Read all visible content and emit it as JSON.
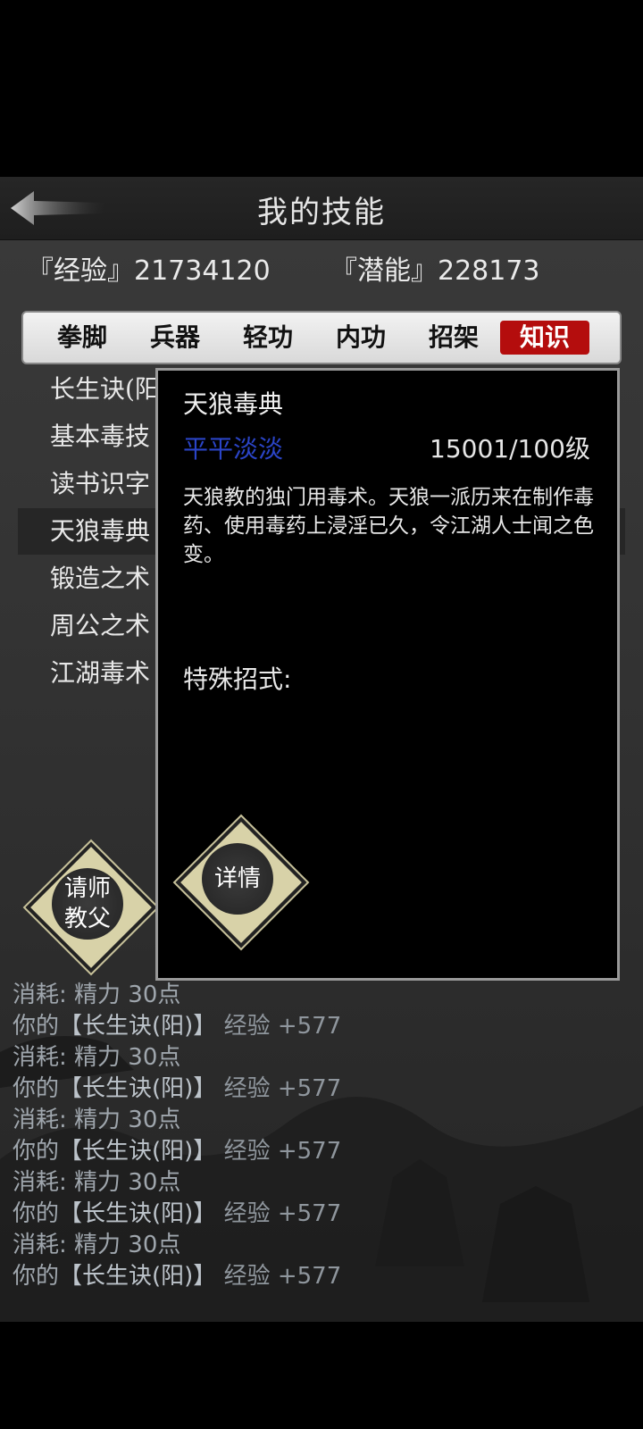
{
  "header": {
    "title": "我的技能",
    "back_label": ""
  },
  "stats": {
    "exp_label": "『经验』",
    "exp_value": "21734120",
    "pot_label": "『潜能』",
    "pot_value": "228173"
  },
  "tabs": [
    {
      "label": "拳脚",
      "active": false
    },
    {
      "label": "兵器",
      "active": false
    },
    {
      "label": "轻功",
      "active": false
    },
    {
      "label": "内功",
      "active": false
    },
    {
      "label": "招架",
      "active": false
    },
    {
      "label": "知识",
      "active": true
    }
  ],
  "skills": [
    {
      "label": "长生诀(阳)",
      "selected": false
    },
    {
      "label": "基本毒技",
      "selected": false
    },
    {
      "label": "读书识字",
      "selected": false
    },
    {
      "label": "天狼毒典",
      "selected": true
    },
    {
      "label": "锻造之术",
      "selected": false
    },
    {
      "label": "周公之术",
      "selected": false
    },
    {
      "label": "江湖毒术",
      "selected": false
    }
  ],
  "popup": {
    "name": "天狼毒典",
    "level_name": "平平淡淡",
    "level_value": "15001/100级",
    "desc": "天狼教的独门用毒术。天狼一派历来在制作毒药、使用毒药上浸淫已久，令江湖人士闻之色变。",
    "special_label": "特殊招式:",
    "detail_button": "详情"
  },
  "teacher_button": {
    "line1": "请师",
    "line2": "教父"
  },
  "log": [
    {
      "p1": "消耗:",
      "p2": " 精力 30点",
      "p3": ""
    },
    {
      "p1": "你的",
      "p2": "【长生诀(阳)】",
      "p3": " 经验 +577"
    },
    {
      "p1": "消耗:",
      "p2": " 精力 30点",
      "p3": ""
    },
    {
      "p1": "你的",
      "p2": "【长生诀(阳)】",
      "p3": " 经验 +577"
    },
    {
      "p1": "消耗:",
      "p2": " 精力 30点",
      "p3": ""
    },
    {
      "p1": "你的",
      "p2": "【长生诀(阳)】",
      "p3": " 经验 +577"
    },
    {
      "p1": "消耗:",
      "p2": " 精力 30点",
      "p3": ""
    },
    {
      "p1": "你的",
      "p2": "【长生诀(阳)】",
      "p3": " 经验 +577"
    },
    {
      "p1": "消耗:",
      "p2": " 精力 30点",
      "p3": ""
    },
    {
      "p1": "你的",
      "p2": "【长生诀(阳)】",
      "p3": " 经验 +577"
    }
  ],
  "colors": {
    "active_tab": "#b40d0d",
    "level_name": "#2a44c6",
    "diamond": "#d8d2a8"
  },
  "icons": {
    "back": "back-arrow-icon"
  }
}
